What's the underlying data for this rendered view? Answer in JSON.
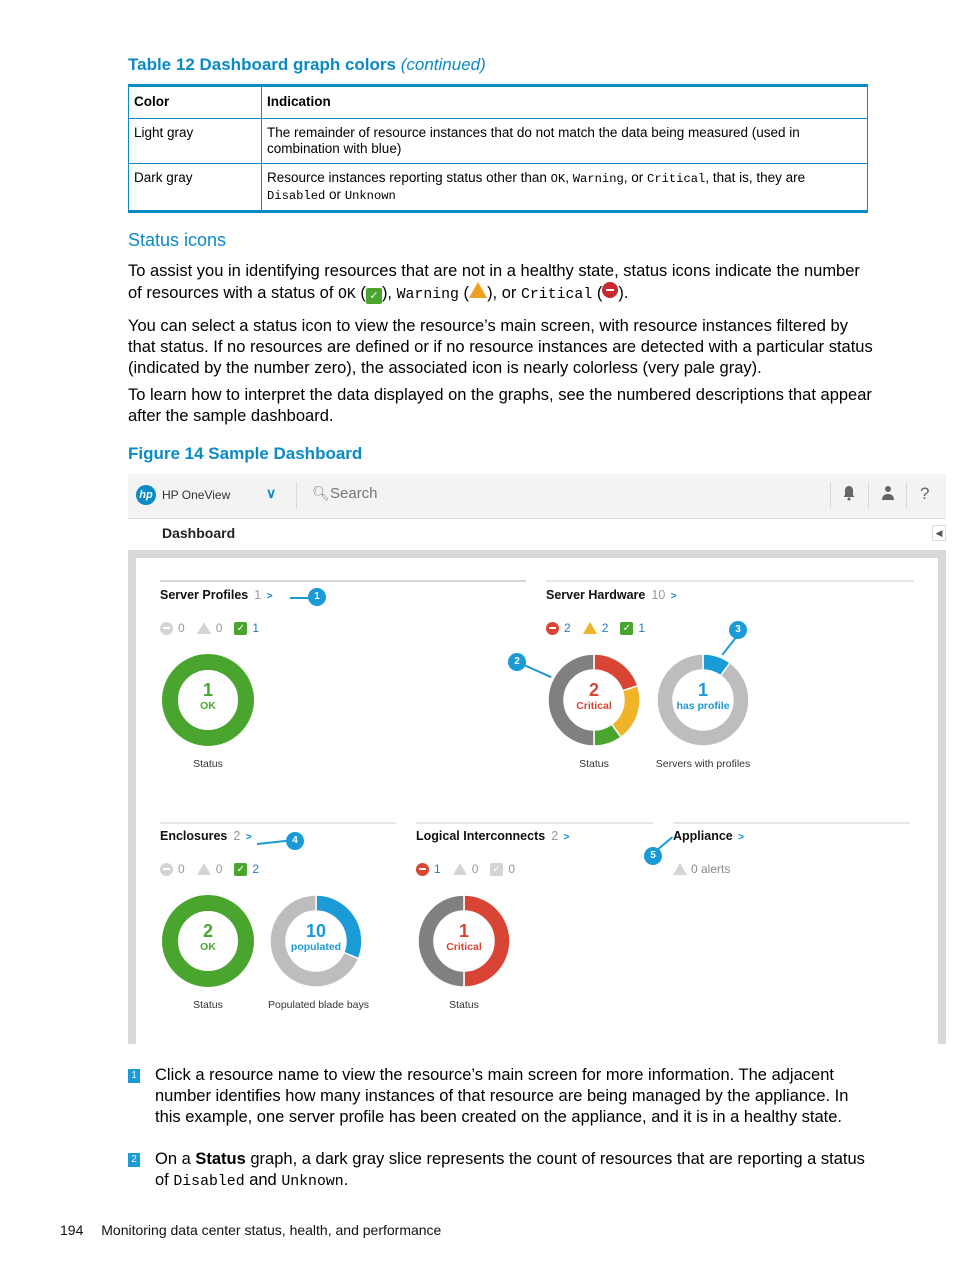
{
  "table": {
    "caption": "Table 12 Dashboard graph colors",
    "caption_suffix": "(continued)",
    "headers": [
      "Color",
      "Indication"
    ],
    "rows": [
      {
        "color": "Light gray",
        "indication": "The remainder of resource instances that do not match the data being measured (used in combination with blue)"
      },
      {
        "color": "Dark gray",
        "indication_parts": [
          "Resource instances reporting status other than ",
          "OK",
          ", ",
          "Warning",
          ", or ",
          "Critical",
          ", that is, they are ",
          "Disabled",
          " or ",
          "Unknown"
        ]
      }
    ]
  },
  "section": {
    "heading": "Status icons",
    "p1_parts": [
      "To assist you in identifying resources that are not in a healthy state, status icons indicate the number of resources with a status of ",
      "OK",
      " (",
      "), ",
      "Warning",
      " (",
      "), or ",
      "Critical",
      " (",
      ")."
    ],
    "p2": "You can select a status icon to view the resource’s main screen, with resource instances filtered by that status. If no resources are defined or if no resource instances are detected with a particular status (indicated by the number zero), the associated icon is nearly colorless (very pale gray).",
    "p3": "To learn how to interpret the data displayed on the graphs, see the numbered descriptions that appear after the sample dashboard."
  },
  "figure": {
    "caption": "Figure 14 Sample Dashboard",
    "topbar": {
      "logo": "hp",
      "app_name": "HP OneView",
      "menu_icon": "chevron-down-icon",
      "search_placeholder": "Search",
      "icons": [
        "bell-icon",
        "user-icon",
        "help-icon"
      ],
      "help_glyph": "?"
    },
    "page_title": "Dashboard",
    "colors": {
      "critical": "#d94535",
      "warning": "#f0b429",
      "ok": "#4aa52e",
      "disabled": "#808080",
      "remainder": "#bdbdbd",
      "highlight": "#1a9ad6",
      "inactive_icon": "#d4d4d4"
    },
    "panels": [
      {
        "title": "Server Profiles",
        "count": "1",
        "chevron": ">",
        "status": {
          "critical": "0",
          "warning": "0",
          "ok": "1"
        },
        "donuts": [
          {
            "caption": "Status",
            "value": "1",
            "label": "OK",
            "label_color": "#4aa52e",
            "slices": [
              {
                "status": "ok",
                "value": 1
              }
            ]
          }
        ]
      },
      {
        "title": "Server Hardware",
        "count": "10",
        "chevron": ">",
        "status": {
          "critical": "2",
          "warning": "2",
          "ok": "1"
        },
        "donuts": [
          {
            "caption": "Status",
            "value": "2",
            "label": "Critical",
            "label_color": "#d94535",
            "slices": [
              {
                "status": "critical",
                "value": 2
              },
              {
                "status": "warning",
                "value": 2
              },
              {
                "status": "ok",
                "value": 1
              },
              {
                "status": "disabled",
                "value": 5
              }
            ]
          },
          {
            "caption": "Servers with profiles",
            "value": "1",
            "label": "has profile",
            "label_color": "#1a9ad6",
            "slices": [
              {
                "status": "highlight",
                "value": 1
              },
              {
                "status": "remainder",
                "value": 9
              }
            ]
          }
        ]
      },
      {
        "title": "Enclosures",
        "count": "2",
        "chevron": ">",
        "status": {
          "critical": "0",
          "warning": "0",
          "ok": "2"
        },
        "donuts": [
          {
            "caption": "Status",
            "value": "2",
            "label": "OK",
            "label_color": "#4aa52e",
            "slices": [
              {
                "status": "ok",
                "value": 2
              }
            ]
          },
          {
            "caption": "Populated blade bays",
            "value": "10",
            "label": "populated",
            "label_color": "#1a9ad6",
            "slices": [
              {
                "status": "highlight",
                "value": 10
              },
              {
                "status": "remainder",
                "value": 22
              }
            ]
          }
        ]
      },
      {
        "title": "Logical Interconnects",
        "count": "2",
        "chevron": ">",
        "status": {
          "critical": "1",
          "warning": "0",
          "ok": "0"
        },
        "donuts": [
          {
            "caption": "Status",
            "value": "1",
            "label": "Critical",
            "label_color": "#d94535",
            "slices": [
              {
                "status": "critical",
                "value": 1
              },
              {
                "status": "disabled",
                "value": 1
              }
            ]
          }
        ]
      },
      {
        "title": "Appliance",
        "count": "",
        "chevron": ">",
        "alerts": "0 alerts"
      }
    ],
    "callouts": [
      "1",
      "2",
      "3",
      "4",
      "5"
    ]
  },
  "notes": [
    {
      "num": "1",
      "text": "Click a resource name to view the resource’s main screen for more information. The adjacent number identifies how many instances of that resource are being managed by the appliance. In this example, one server profile has been created on the appliance, and it is in a healthy state."
    },
    {
      "num": "2",
      "parts": [
        "On a ",
        "Status",
        " graph, a dark gray slice represents the count of resources that are reporting a status of ",
        "Disabled",
        " and ",
        "Unknown",
        "."
      ]
    }
  ],
  "footer": {
    "page": "194",
    "text": "Monitoring data center status, health, and performance"
  }
}
